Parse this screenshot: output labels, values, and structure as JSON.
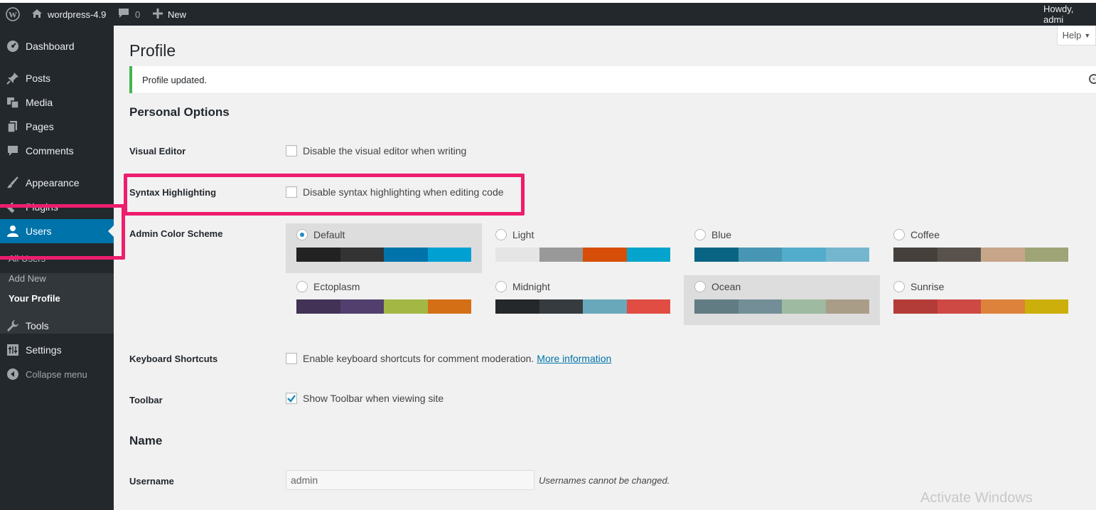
{
  "adminbar": {
    "site_name": "wordpress-4.9",
    "comments_count": "0",
    "new_label": "New",
    "howdy": "Howdy, admi"
  },
  "sidebar": {
    "items": [
      {
        "label": "Dashboard",
        "icon": "dashboard-icon"
      },
      {
        "label": "Posts",
        "icon": "pushpin-icon"
      },
      {
        "label": "Media",
        "icon": "media-icon"
      },
      {
        "label": "Pages",
        "icon": "page-icon"
      },
      {
        "label": "Comments",
        "icon": "comment-icon"
      },
      {
        "label": "Appearance",
        "icon": "paintbrush-icon"
      },
      {
        "label": "Plugins",
        "icon": "plugin-icon"
      },
      {
        "label": "Users",
        "icon": "user-icon"
      },
      {
        "label": "Tools",
        "icon": "wrench-icon"
      },
      {
        "label": "Settings",
        "icon": "settings-icon"
      },
      {
        "label": "Collapse menu",
        "icon": "collapse-icon"
      }
    ],
    "users_submenu": [
      "All Users",
      "Add New",
      "Your Profile"
    ]
  },
  "help_label": "Help",
  "page_title": "Profile",
  "notice": "Profile updated.",
  "sections": {
    "personal_options": "Personal Options",
    "name": "Name"
  },
  "fields": {
    "visual_editor": {
      "label": "Visual Editor",
      "text": "Disable the visual editor when writing",
      "checked": false
    },
    "syntax": {
      "label": "Syntax Highlighting",
      "text": "Disable syntax highlighting when editing code",
      "checked": false
    },
    "color_scheme_label": "Admin Color Scheme",
    "keyboard": {
      "label": "Keyboard Shortcuts",
      "text": "Enable keyboard shortcuts for comment moderation.",
      "link": "More information",
      "checked": false
    },
    "toolbar": {
      "label": "Toolbar",
      "text": "Show Toolbar when viewing site",
      "checked": true
    },
    "username": {
      "label": "Username",
      "value": "admin",
      "description": "Usernames cannot be changed."
    }
  },
  "color_schemes": [
    {
      "name": "Default",
      "selected": true,
      "colors": [
        "#222222",
        "#333333",
        "#0073aa",
        "#00a0d2"
      ]
    },
    {
      "name": "Light",
      "selected": false,
      "colors": [
        "#e5e5e5",
        "#999999",
        "#d64e07",
        "#04a4cc"
      ]
    },
    {
      "name": "Blue",
      "selected": false,
      "colors": [
        "#096484",
        "#4796b3",
        "#52accc",
        "#74b6ce"
      ]
    },
    {
      "name": "Coffee",
      "selected": false,
      "colors": [
        "#46403c",
        "#59524c",
        "#c7a589",
        "#9ea476"
      ]
    },
    {
      "name": "Ectoplasm",
      "selected": false,
      "colors": [
        "#413256",
        "#523f6d",
        "#a3b745",
        "#d46f15"
      ]
    },
    {
      "name": "Midnight",
      "selected": false,
      "colors": [
        "#25282b",
        "#363b3f",
        "#69a8bb",
        "#e14d43"
      ]
    },
    {
      "name": "Ocean",
      "selected": false,
      "hover": true,
      "colors": [
        "#627c83",
        "#738e96",
        "#9ebaa0",
        "#aa9d88"
      ]
    },
    {
      "name": "Sunrise",
      "selected": false,
      "colors": [
        "#b43c38",
        "#cf4944",
        "#dd823b",
        "#ccaf0b"
      ]
    }
  ],
  "watermark": "Activate Windows",
  "colors": {
    "accent": "#0073aa",
    "highlight_box": "#ee1d6d",
    "notice_border": "#46b450"
  }
}
